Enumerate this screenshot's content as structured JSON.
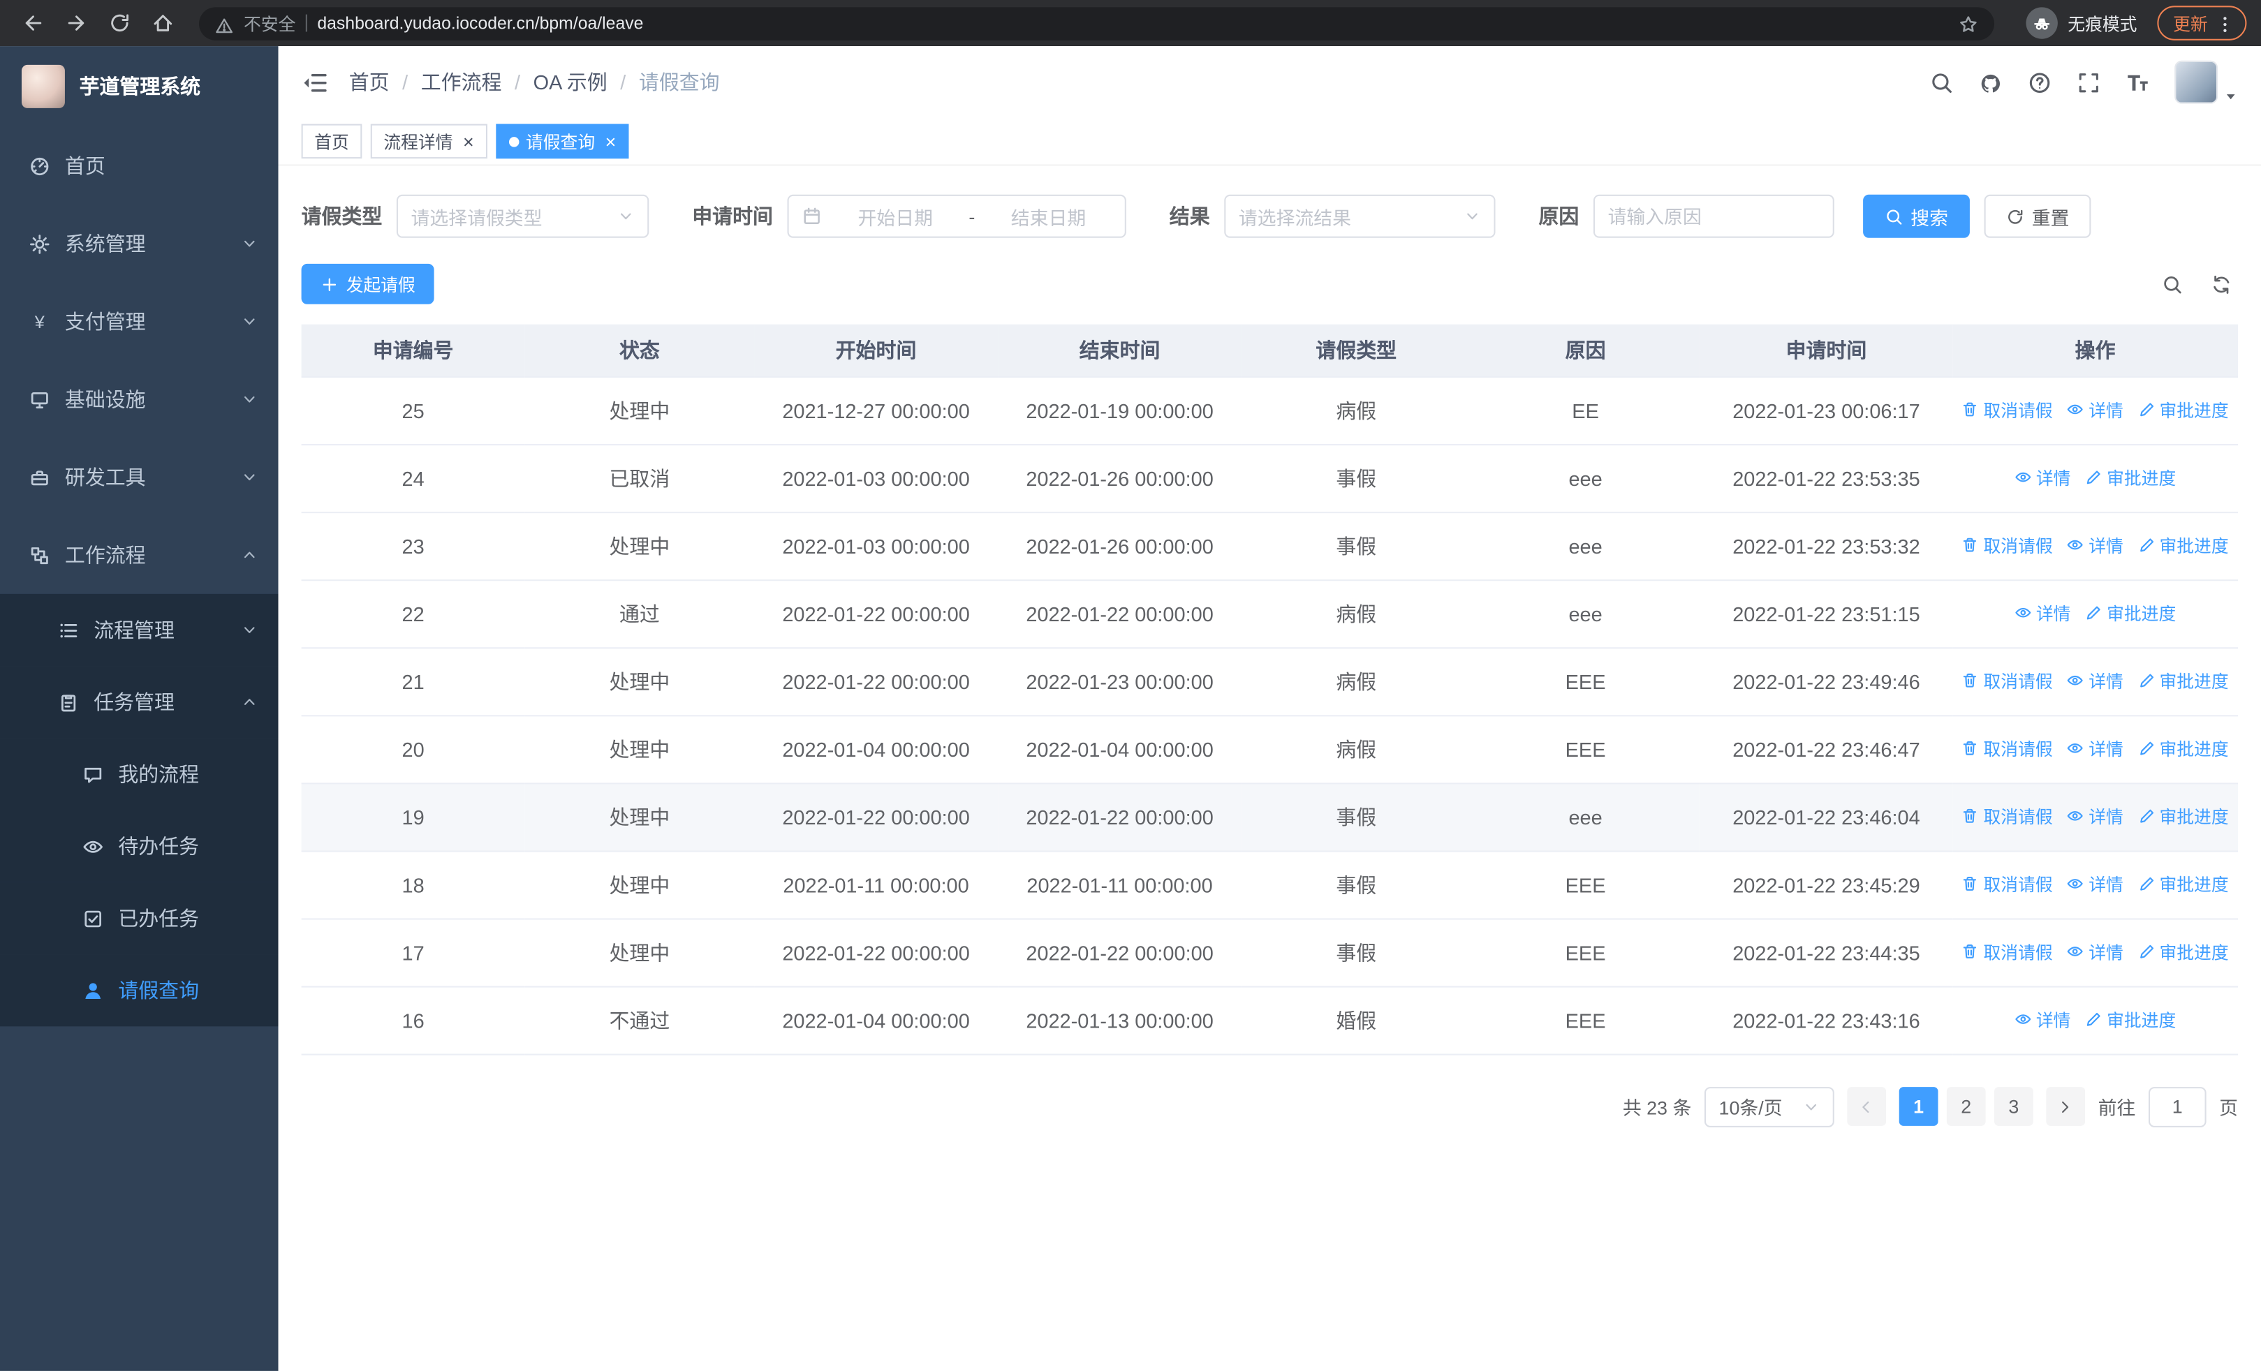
{
  "browser": {
    "not_secure_label": "不安全",
    "url": "dashboard.yudao.iocoder.cn/bpm/oa/leave",
    "incognito_label": "无痕模式",
    "update_label": "更新"
  },
  "sidebar": {
    "app_title": "芋道管理系统",
    "menu": [
      {
        "name": "home",
        "label": "首页",
        "icon": "menu-home",
        "level": 0
      },
      {
        "name": "system-management",
        "label": "系统管理",
        "icon": "menu-gear",
        "level": 0,
        "chevron": "down"
      },
      {
        "name": "payment-management",
        "label": "支付管理",
        "icon": "menu-pay",
        "level": 0,
        "chevron": "down"
      },
      {
        "name": "infrastructure",
        "label": "基础设施",
        "icon": "menu-infra",
        "level": 0,
        "chevron": "down"
      },
      {
        "name": "dev-tools",
        "label": "研发工具",
        "icon": "menu-tools",
        "level": 0,
        "chevron": "down"
      },
      {
        "name": "workflow",
        "label": "工作流程",
        "icon": "menu-flow",
        "level": 0,
        "chevron": "up"
      },
      {
        "name": "process-management",
        "label": "流程管理",
        "icon": "menu-process",
        "level": 1,
        "chevron": "down"
      },
      {
        "name": "task-management",
        "label": "任务管理",
        "icon": "menu-task",
        "level": 1,
        "chevron": "up"
      },
      {
        "name": "my-process",
        "label": "我的流程",
        "icon": "menu-myflow",
        "level": 2
      },
      {
        "name": "todo-tasks",
        "label": "待办任务",
        "icon": "menu-todo",
        "level": 2
      },
      {
        "name": "done-tasks",
        "label": "已办任务",
        "icon": "menu-done",
        "level": 2
      },
      {
        "name": "leave-query",
        "label": "请假查询",
        "icon": "menu-user",
        "level": 2,
        "active": true
      }
    ]
  },
  "header": {
    "breadcrumb": [
      "首页",
      "工作流程",
      "OA 示例",
      "请假查询"
    ]
  },
  "tabs": [
    {
      "name": "home",
      "label": "首页",
      "closable": false,
      "active": false
    },
    {
      "name": "process-detail",
      "label": "流程详情",
      "closable": true,
      "active": false
    },
    {
      "name": "leave-query",
      "label": "请假查询",
      "closable": true,
      "active": true
    }
  ],
  "filters": {
    "leave_type_label": "请假类型",
    "leave_type_placeholder": "请选择请假类型",
    "apply_time_label": "申请时间",
    "start_date_placeholder": "开始日期",
    "range_separator": "-",
    "end_date_placeholder": "结束日期",
    "result_label": "结果",
    "result_placeholder": "请选择流结果",
    "reason_label": "原因",
    "reason_placeholder": "请输入原因",
    "search_label": "搜索",
    "reset_label": "重置"
  },
  "toolbar": {
    "create_label": "发起请假"
  },
  "table": {
    "columns": [
      "申请编号",
      "状态",
      "开始时间",
      "结束时间",
      "请假类型",
      "原因",
      "申请时间",
      "操作"
    ],
    "actions": {
      "cancel": "取消请假",
      "detail": "详情",
      "progress": "审批进度"
    },
    "rows": [
      {
        "id": "25",
        "status": "处理中",
        "start": "2021-12-27 00:00:00",
        "end": "2022-01-19 00:00:00",
        "type": "病假",
        "reason": "EE",
        "applied": "2022-01-23 00:06:17",
        "can_cancel": true,
        "hover": false
      },
      {
        "id": "24",
        "status": "已取消",
        "start": "2022-01-03 00:00:00",
        "end": "2022-01-26 00:00:00",
        "type": "事假",
        "reason": "eee",
        "applied": "2022-01-22 23:53:35",
        "can_cancel": false,
        "hover": false
      },
      {
        "id": "23",
        "status": "处理中",
        "start": "2022-01-03 00:00:00",
        "end": "2022-01-26 00:00:00",
        "type": "事假",
        "reason": "eee",
        "applied": "2022-01-22 23:53:32",
        "can_cancel": true,
        "hover": false
      },
      {
        "id": "22",
        "status": "通过",
        "start": "2022-01-22 00:00:00",
        "end": "2022-01-22 00:00:00",
        "type": "病假",
        "reason": "eee",
        "applied": "2022-01-22 23:51:15",
        "can_cancel": false,
        "hover": false
      },
      {
        "id": "21",
        "status": "处理中",
        "start": "2022-01-22 00:00:00",
        "end": "2022-01-23 00:00:00",
        "type": "病假",
        "reason": "EEE",
        "applied": "2022-01-22 23:49:46",
        "can_cancel": true,
        "hover": false
      },
      {
        "id": "20",
        "status": "处理中",
        "start": "2022-01-04 00:00:00",
        "end": "2022-01-04 00:00:00",
        "type": "病假",
        "reason": "EEE",
        "applied": "2022-01-22 23:46:47",
        "can_cancel": true,
        "hover": false
      },
      {
        "id": "19",
        "status": "处理中",
        "start": "2022-01-22 00:00:00",
        "end": "2022-01-22 00:00:00",
        "type": "事假",
        "reason": "eee",
        "applied": "2022-01-22 23:46:04",
        "can_cancel": true,
        "hover": true
      },
      {
        "id": "18",
        "status": "处理中",
        "start": "2022-01-11 00:00:00",
        "end": "2022-01-11 00:00:00",
        "type": "事假",
        "reason": "EEE",
        "applied": "2022-01-22 23:45:29",
        "can_cancel": true,
        "hover": false
      },
      {
        "id": "17",
        "status": "处理中",
        "start": "2022-01-22 00:00:00",
        "end": "2022-01-22 00:00:00",
        "type": "事假",
        "reason": "EEE",
        "applied": "2022-01-22 23:44:35",
        "can_cancel": true,
        "hover": false
      },
      {
        "id": "16",
        "status": "不通过",
        "start": "2022-01-04 00:00:00",
        "end": "2022-01-13 00:00:00",
        "type": "婚假",
        "reason": "EEE",
        "applied": "2022-01-22 23:43:16",
        "can_cancel": false,
        "hover": false
      }
    ]
  },
  "pagination": {
    "total_label": "共 23 条",
    "page_size_label": "10条/页",
    "pages": [
      "1",
      "2",
      "3"
    ],
    "active_page": "1",
    "goto_label": "前往",
    "goto_value": "1",
    "page_suffix": "页"
  },
  "colors": {
    "primary": "#409eff",
    "sidebar_bg": "#304156",
    "submenu_bg": "#1f2d3d",
    "update_accent": "#ee8152"
  }
}
